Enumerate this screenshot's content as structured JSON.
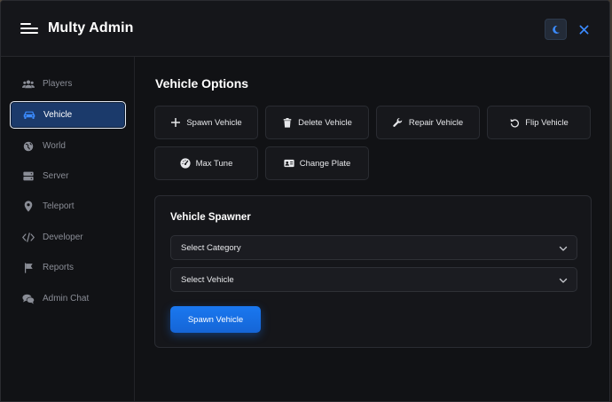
{
  "header": {
    "title": "Multy Admin"
  },
  "sidebar": {
    "items": [
      {
        "label": "Players",
        "icon": "users-icon"
      },
      {
        "label": "Vehicle",
        "icon": "car-icon"
      },
      {
        "label": "World",
        "icon": "globe-icon"
      },
      {
        "label": "Server",
        "icon": "server-icon"
      },
      {
        "label": "Teleport",
        "icon": "map-pin-icon"
      },
      {
        "label": "Developer",
        "icon": "code-icon"
      },
      {
        "label": "Reports",
        "icon": "flag-icon"
      },
      {
        "label": "Admin Chat",
        "icon": "chat-icon"
      }
    ],
    "active": "Vehicle"
  },
  "main": {
    "title": "Vehicle Options",
    "options": [
      {
        "label": "Spawn Vehicle",
        "icon": "plus-icon"
      },
      {
        "label": "Delete Vehicle",
        "icon": "trash-icon"
      },
      {
        "label": "Repair Vehicle",
        "icon": "wrench-icon"
      },
      {
        "label": "Flip Vehicle",
        "icon": "rotate-icon"
      },
      {
        "label": "Max Tune",
        "icon": "gauge-icon"
      },
      {
        "label": "Change Plate",
        "icon": "id-card-icon"
      }
    ],
    "spawner": {
      "title": "Vehicle Spawner",
      "category_value": "Select Category",
      "vehicle_value": "Select Vehicle",
      "spawn_label": "Spawn Vehicle"
    }
  },
  "colors": {
    "accent": "#1a6fe6",
    "background": "#111215",
    "active_nav": "#1b3a6b"
  }
}
